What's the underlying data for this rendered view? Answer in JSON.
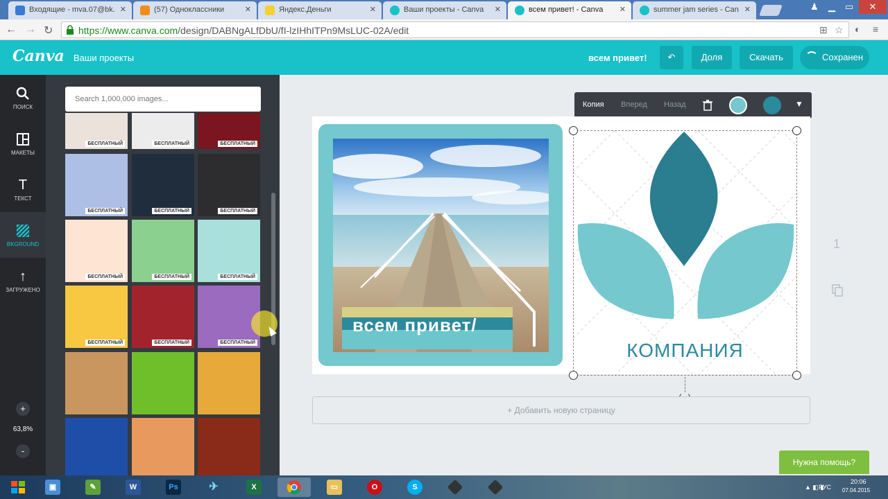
{
  "browser": {
    "tabs": [
      {
        "title": "Входящие - mva.07@bk.",
        "favicon_color": "#3a7bd5"
      },
      {
        "title": "(57) Одноклассники",
        "favicon_color": "#f28c18"
      },
      {
        "title": "Яндекс.Деньги",
        "favicon_color": "#f5d033"
      },
      {
        "title": "Ваши проекты - Canva",
        "favicon_color": "#19c1c9"
      },
      {
        "title": "всем привет! - Canva",
        "favicon_color": "#19c1c9",
        "active": true
      },
      {
        "title": "summer jam series - Can",
        "favicon_color": "#19c1c9"
      }
    ],
    "url_host": "https://www.canva.com",
    "url_path": "/design/DABNgALfDbU/fI-lzIHhITPn9MsLUC-02A/edit"
  },
  "header": {
    "logo": "Canva",
    "projects_link": "Ваши проекты",
    "doc_title": "всем привет!",
    "undo_icon": "undo-icon",
    "share_label": "Доля",
    "download_label": "Скачать",
    "save_label": "Сохранен"
  },
  "rail": {
    "items": [
      {
        "label": "ПОИСК",
        "icon": "search-icon"
      },
      {
        "label": "МАКЕТЫ",
        "icon": "layouts-icon"
      },
      {
        "label": "ТЕКСТ",
        "icon": "text-icon"
      },
      {
        "label": "BKGROUND",
        "icon": "background-icon",
        "active": true
      },
      {
        "label": "ЗАГРУЖЕНО",
        "icon": "upload-icon"
      }
    ],
    "zoom_in": "+",
    "zoom_value": "63,8%",
    "zoom_out": "-"
  },
  "panel": {
    "search_placeholder": "Search 1,000,000 images...",
    "badge_label": "БЕСПЛАТНЫЙ",
    "tiles": [
      {
        "color": "#ece2dc",
        "badge": true
      },
      {
        "color": "#ececec",
        "badge": true
      },
      {
        "color": "#7b1620",
        "badge": true
      },
      {
        "color": "#aebfe6",
        "badge": true
      },
      {
        "color": "#1f2d3d",
        "badge": true
      },
      {
        "color": "#2d2d2f",
        "badge": true
      },
      {
        "color": "#fde4d3",
        "badge": true
      },
      {
        "color": "#8cd08f",
        "badge": true
      },
      {
        "color": "#a9e0dc",
        "badge": true
      },
      {
        "color": "#f8c843",
        "badge": true
      },
      {
        "color": "#a3232d",
        "badge": true
      },
      {
        "color": "#9b6bc0",
        "badge": true
      },
      {
        "color": "#c99660",
        "badge": false
      },
      {
        "color": "#6fbf2a",
        "badge": false
      },
      {
        "color": "#e7a93a",
        "badge": false
      },
      {
        "color": "#1f4ea8",
        "badge": false
      },
      {
        "color": "#e89a5e",
        "badge": false
      },
      {
        "color": "#8a2a18",
        "badge": false
      }
    ]
  },
  "toolbar": {
    "copy_label": "Копия",
    "forward_label": "Вперед",
    "back_label": "Назад",
    "delete_icon": "trash-icon",
    "swatch_1": "#74c8ce",
    "swatch_2": "#2b8a9c"
  },
  "canvas": {
    "caption_text": "всем привет/",
    "company_text": "КОМПАНИЯ",
    "frame_color": "#74c8ce",
    "leaf_dark": "#2b7d90",
    "leaf_light": "#74c8ce",
    "page_number": "1",
    "add_page_label": "+ Добавить новую страницу"
  },
  "help_label": "Нужна помощь?",
  "taskbar": {
    "lang": "РУС",
    "time": "20:06",
    "date": "07.04.2015"
  }
}
